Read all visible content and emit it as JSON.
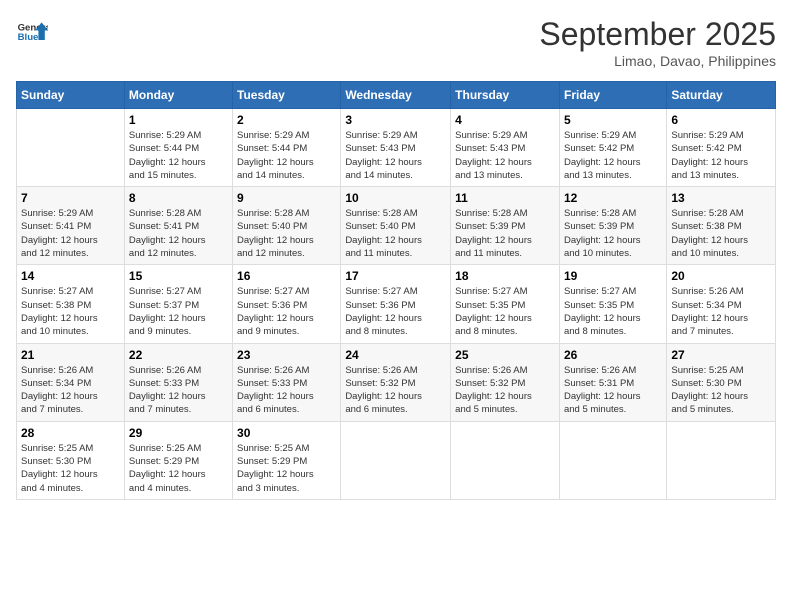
{
  "header": {
    "logo_line1": "General",
    "logo_line2": "Blue",
    "month": "September 2025",
    "location": "Limao, Davao, Philippines"
  },
  "weekdays": [
    "Sunday",
    "Monday",
    "Tuesday",
    "Wednesday",
    "Thursday",
    "Friday",
    "Saturday"
  ],
  "weeks": [
    [
      {
        "day": "",
        "info": ""
      },
      {
        "day": "1",
        "info": "Sunrise: 5:29 AM\nSunset: 5:44 PM\nDaylight: 12 hours\nand 15 minutes."
      },
      {
        "day": "2",
        "info": "Sunrise: 5:29 AM\nSunset: 5:44 PM\nDaylight: 12 hours\nand 14 minutes."
      },
      {
        "day": "3",
        "info": "Sunrise: 5:29 AM\nSunset: 5:43 PM\nDaylight: 12 hours\nand 14 minutes."
      },
      {
        "day": "4",
        "info": "Sunrise: 5:29 AM\nSunset: 5:43 PM\nDaylight: 12 hours\nand 13 minutes."
      },
      {
        "day": "5",
        "info": "Sunrise: 5:29 AM\nSunset: 5:42 PM\nDaylight: 12 hours\nand 13 minutes."
      },
      {
        "day": "6",
        "info": "Sunrise: 5:29 AM\nSunset: 5:42 PM\nDaylight: 12 hours\nand 13 minutes."
      }
    ],
    [
      {
        "day": "7",
        "info": "Sunrise: 5:29 AM\nSunset: 5:41 PM\nDaylight: 12 hours\nand 12 minutes."
      },
      {
        "day": "8",
        "info": "Sunrise: 5:28 AM\nSunset: 5:41 PM\nDaylight: 12 hours\nand 12 minutes."
      },
      {
        "day": "9",
        "info": "Sunrise: 5:28 AM\nSunset: 5:40 PM\nDaylight: 12 hours\nand 12 minutes."
      },
      {
        "day": "10",
        "info": "Sunrise: 5:28 AM\nSunset: 5:40 PM\nDaylight: 12 hours\nand 11 minutes."
      },
      {
        "day": "11",
        "info": "Sunrise: 5:28 AM\nSunset: 5:39 PM\nDaylight: 12 hours\nand 11 minutes."
      },
      {
        "day": "12",
        "info": "Sunrise: 5:28 AM\nSunset: 5:39 PM\nDaylight: 12 hours\nand 10 minutes."
      },
      {
        "day": "13",
        "info": "Sunrise: 5:28 AM\nSunset: 5:38 PM\nDaylight: 12 hours\nand 10 minutes."
      }
    ],
    [
      {
        "day": "14",
        "info": "Sunrise: 5:27 AM\nSunset: 5:38 PM\nDaylight: 12 hours\nand 10 minutes."
      },
      {
        "day": "15",
        "info": "Sunrise: 5:27 AM\nSunset: 5:37 PM\nDaylight: 12 hours\nand 9 minutes."
      },
      {
        "day": "16",
        "info": "Sunrise: 5:27 AM\nSunset: 5:36 PM\nDaylight: 12 hours\nand 9 minutes."
      },
      {
        "day": "17",
        "info": "Sunrise: 5:27 AM\nSunset: 5:36 PM\nDaylight: 12 hours\nand 8 minutes."
      },
      {
        "day": "18",
        "info": "Sunrise: 5:27 AM\nSunset: 5:35 PM\nDaylight: 12 hours\nand 8 minutes."
      },
      {
        "day": "19",
        "info": "Sunrise: 5:27 AM\nSunset: 5:35 PM\nDaylight: 12 hours\nand 8 minutes."
      },
      {
        "day": "20",
        "info": "Sunrise: 5:26 AM\nSunset: 5:34 PM\nDaylight: 12 hours\nand 7 minutes."
      }
    ],
    [
      {
        "day": "21",
        "info": "Sunrise: 5:26 AM\nSunset: 5:34 PM\nDaylight: 12 hours\nand 7 minutes."
      },
      {
        "day": "22",
        "info": "Sunrise: 5:26 AM\nSunset: 5:33 PM\nDaylight: 12 hours\nand 7 minutes."
      },
      {
        "day": "23",
        "info": "Sunrise: 5:26 AM\nSunset: 5:33 PM\nDaylight: 12 hours\nand 6 minutes."
      },
      {
        "day": "24",
        "info": "Sunrise: 5:26 AM\nSunset: 5:32 PM\nDaylight: 12 hours\nand 6 minutes."
      },
      {
        "day": "25",
        "info": "Sunrise: 5:26 AM\nSunset: 5:32 PM\nDaylight: 12 hours\nand 5 minutes."
      },
      {
        "day": "26",
        "info": "Sunrise: 5:26 AM\nSunset: 5:31 PM\nDaylight: 12 hours\nand 5 minutes."
      },
      {
        "day": "27",
        "info": "Sunrise: 5:25 AM\nSunset: 5:30 PM\nDaylight: 12 hours\nand 5 minutes."
      }
    ],
    [
      {
        "day": "28",
        "info": "Sunrise: 5:25 AM\nSunset: 5:30 PM\nDaylight: 12 hours\nand 4 minutes."
      },
      {
        "day": "29",
        "info": "Sunrise: 5:25 AM\nSunset: 5:29 PM\nDaylight: 12 hours\nand 4 minutes."
      },
      {
        "day": "30",
        "info": "Sunrise: 5:25 AM\nSunset: 5:29 PM\nDaylight: 12 hours\nand 3 minutes."
      },
      {
        "day": "",
        "info": ""
      },
      {
        "day": "",
        "info": ""
      },
      {
        "day": "",
        "info": ""
      },
      {
        "day": "",
        "info": ""
      }
    ]
  ]
}
